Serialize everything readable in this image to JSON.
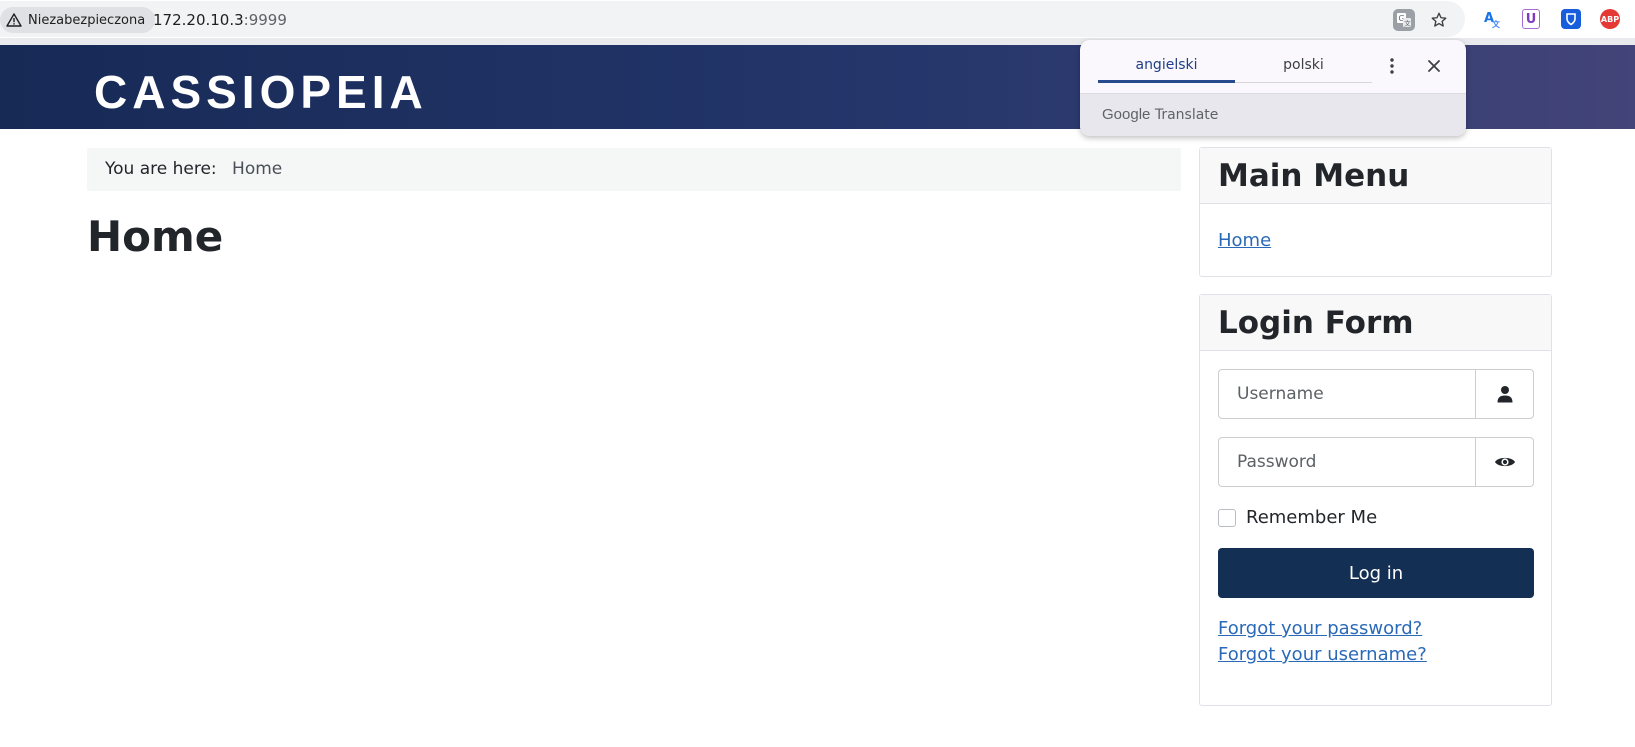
{
  "browser": {
    "security_label": "Niezabezpieczona",
    "url_host": "172.20.10.3",
    "url_port": ":9999",
    "icons": [
      "warning-icon",
      "translate-icon",
      "star-icon",
      "google-translate-extension-icon",
      "u-extension-icon",
      "bitwarden-extension-icon",
      "adblock-plus-extension-icon"
    ],
    "abp_label": "ABP",
    "u_label": "U"
  },
  "translate_popup": {
    "tabs": [
      {
        "label": "angielski",
        "active": true
      },
      {
        "label": "polski",
        "active": false
      }
    ],
    "footer_google": "Google",
    "footer_translate": "Translate"
  },
  "site": {
    "logo": "CASSIOPEIA",
    "header_colors": [
      "#172a56",
      "#434479"
    ]
  },
  "breadcrumb": {
    "prefix": "You are here:",
    "items": [
      "Home"
    ]
  },
  "page": {
    "title": "Home"
  },
  "main_menu": {
    "title": "Main Menu",
    "items": [
      {
        "label": "Home"
      }
    ]
  },
  "login_form": {
    "title": "Login Form",
    "username_placeholder": "Username",
    "password_placeholder": "Password",
    "remember_label": "Remember Me",
    "login_button": "Log in",
    "forgot_password": "Forgot your password?",
    "forgot_username": "Forgot your username?",
    "button_color": "#132f53"
  }
}
